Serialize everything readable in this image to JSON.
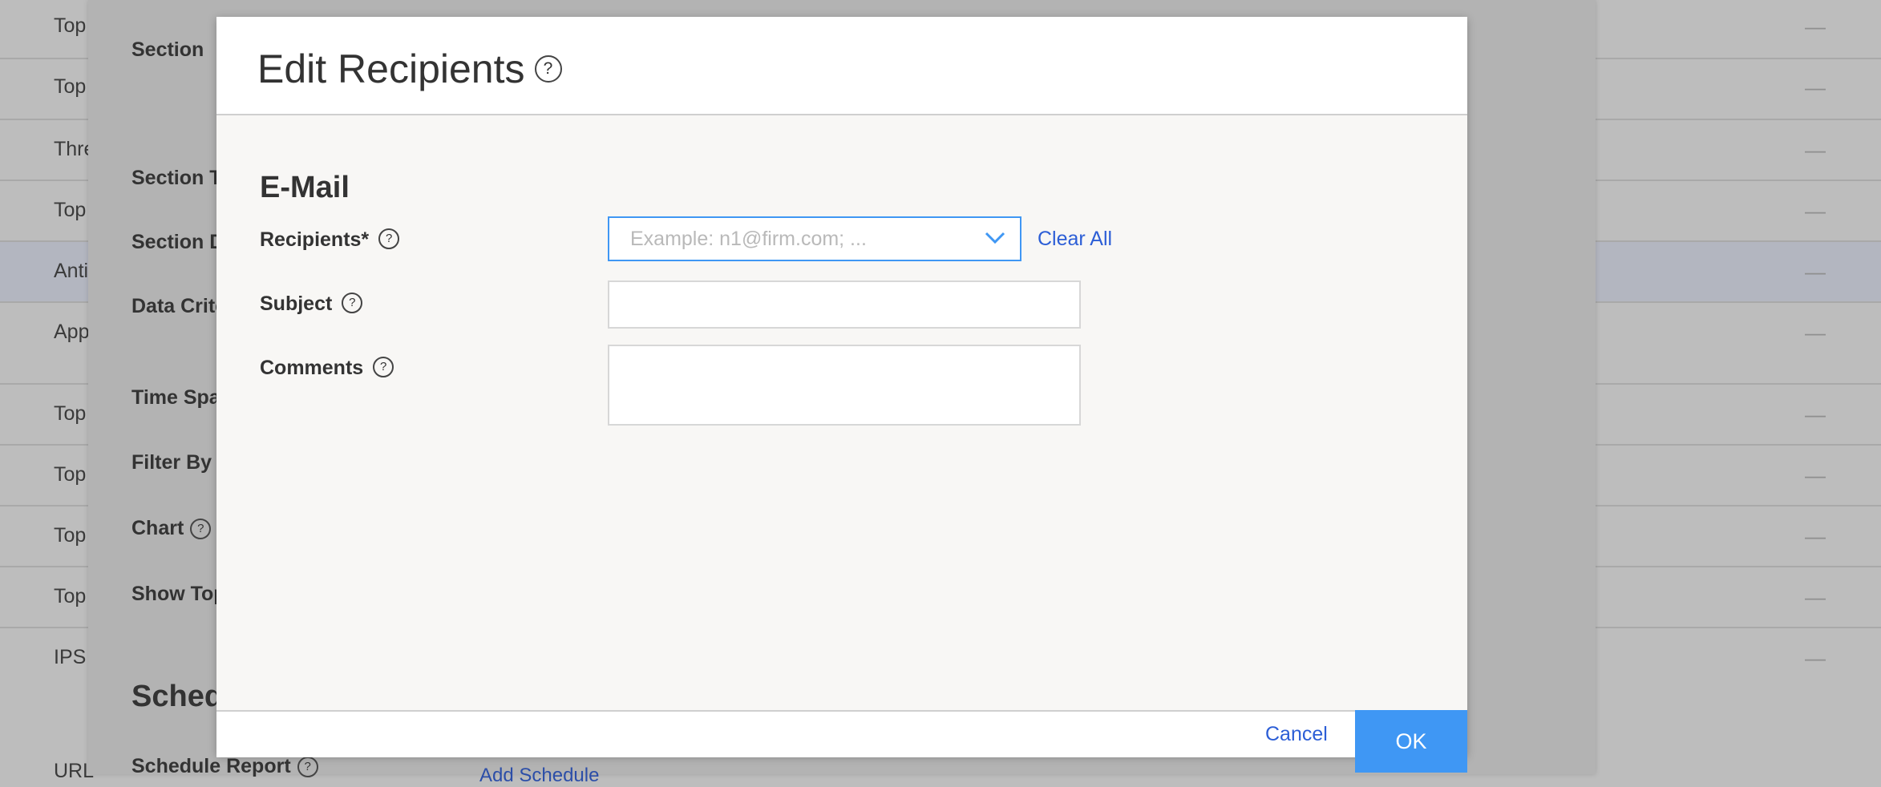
{
  "background": {
    "list_rows": [
      {
        "label": "Top",
        "selected": false
      },
      {
        "label": "Top",
        "selected": false
      },
      {
        "label": "Thre",
        "selected": false
      },
      {
        "label": "Top",
        "selected": false
      },
      {
        "label": "Anti",
        "selected": true
      },
      {
        "label": "App",
        "selected": false
      },
      {
        "label": "Top",
        "selected": false
      },
      {
        "label": "Top",
        "selected": false
      },
      {
        "label": "Top",
        "selected": false
      },
      {
        "label": "Top",
        "selected": false
      },
      {
        "label": "IPS",
        "selected": false
      },
      {
        "label": "URL",
        "selected": false
      }
    ],
    "row_dash": "—",
    "fields": {
      "section": "Section",
      "section_t": "Section T",
      "section_d": "Section D",
      "data_crit": "Data Crite",
      "time_span": "Time Spa",
      "filter_by": "Filter By",
      "chart": "Chart",
      "show_top": "Show Top",
      "schedule_report": "Schedule Report"
    },
    "schedule_heading": "Sched",
    "add_schedule_link": "Add Schedule",
    "help_glyph": "?"
  },
  "modal": {
    "title": "Edit Recipients",
    "help_glyph": "?",
    "section_title": "E-Mail",
    "recipients": {
      "label": "Recipients*",
      "placeholder": "Example: n1@firm.com; ...",
      "value": "",
      "clear_label": "Clear All"
    },
    "subject": {
      "label": "Subject",
      "value": ""
    },
    "comments": {
      "label": "Comments",
      "value": ""
    },
    "cancel_label": "Cancel",
    "ok_label": "OK"
  },
  "colors": {
    "accent": "#3f97f4",
    "link": "#2c5ed6",
    "overlay_background": "#bdbdbd"
  },
  "icons": {
    "help": "help-circle-icon",
    "dropdown": "chevron-down-icon"
  }
}
